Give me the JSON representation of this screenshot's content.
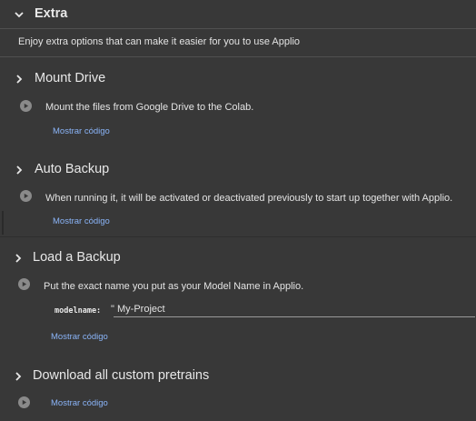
{
  "extra": {
    "title": "Extra",
    "description": "Enjoy extra options that can make it easier for you to use Applio"
  },
  "sections": {
    "mount_drive": {
      "title": "Mount Drive",
      "description": "Mount the files from Google Drive to the Colab.",
      "show_code": "Mostrar código"
    },
    "auto_backup": {
      "title": "Auto Backup",
      "description": "When running it, it will be activated or deactivated previously to start up together with Applio.",
      "show_code": "Mostrar código"
    },
    "load_backup": {
      "title": "Load a Backup",
      "description": "Put the exact name you put as your Model Name in Applio.",
      "field_label": "modelname:",
      "field_quote": "\"",
      "field_value": "My-Project",
      "show_code": "Mostrar código"
    },
    "download_pretrains": {
      "title": "Download all custom pretrains",
      "show_code": "Mostrar código"
    }
  },
  "icons": {
    "chevron": "chevron-icon",
    "play": "play-icon"
  },
  "colors": {
    "background": "#383838",
    "link": "#8ab4f8",
    "play_button": "#8a8a8a"
  }
}
